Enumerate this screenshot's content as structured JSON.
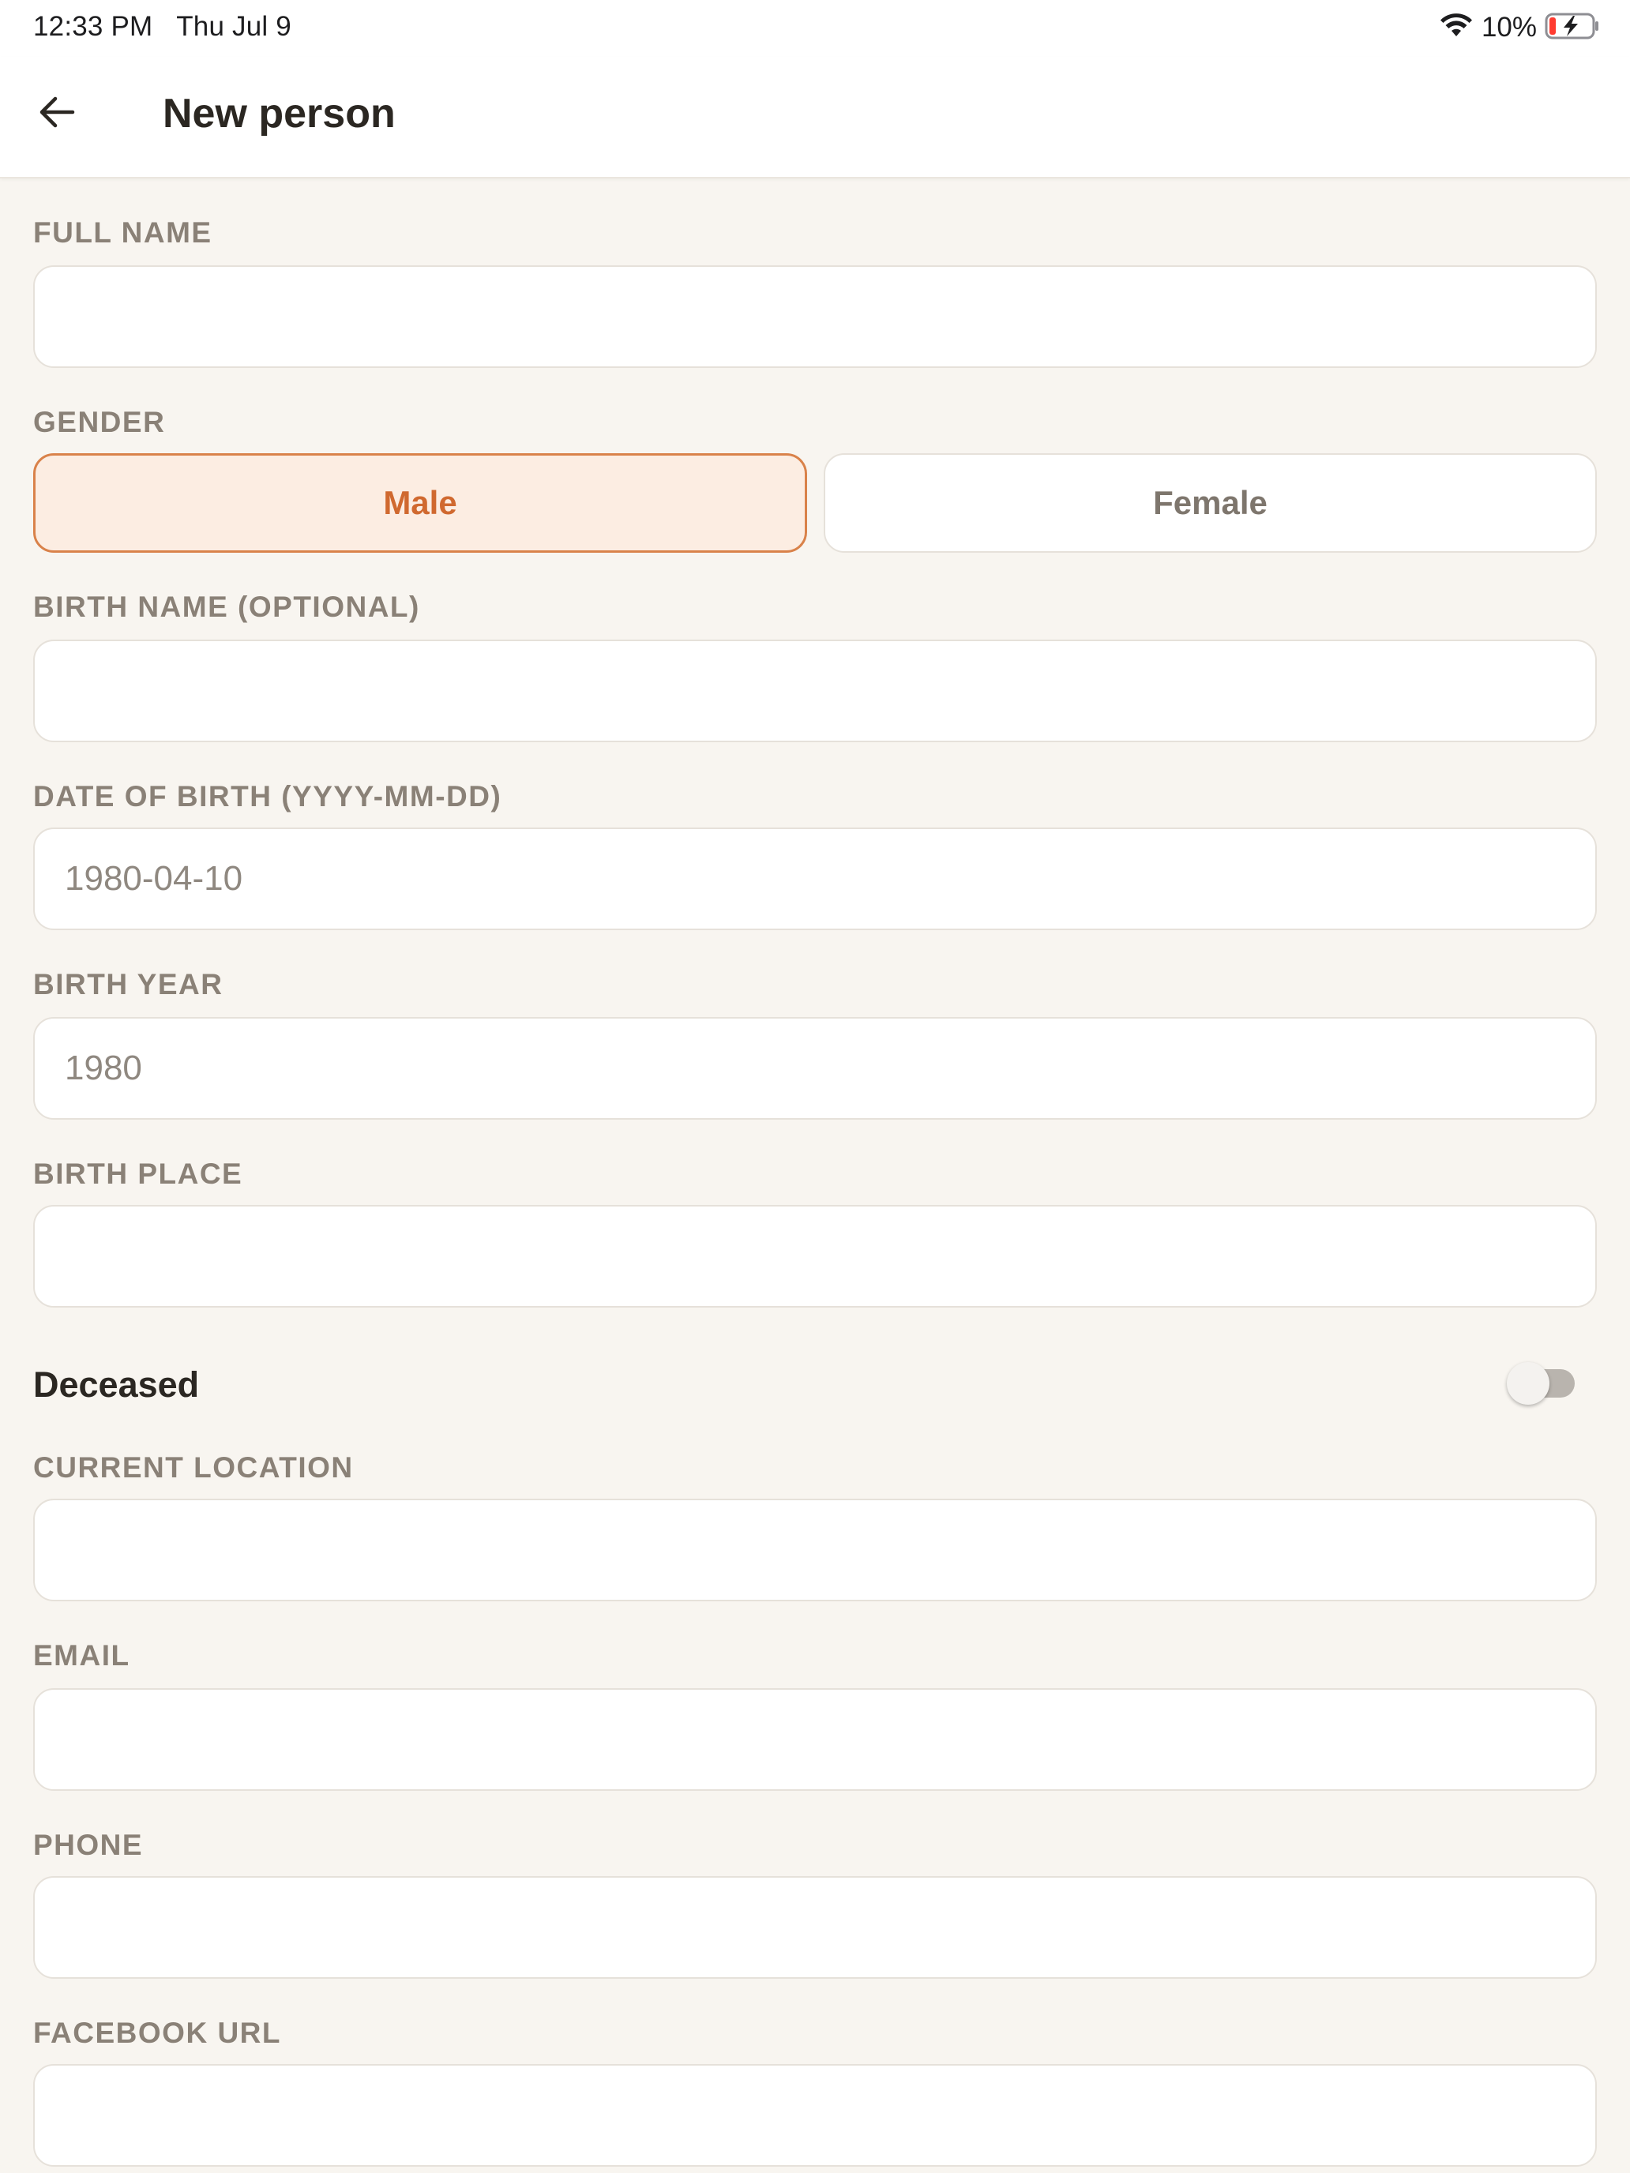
{
  "status_bar": {
    "time": "12:33 PM",
    "date": "Thu Jul 9",
    "battery_percent": "10%",
    "icons": [
      "wifi-icon",
      "battery-charging-icon"
    ]
  },
  "header": {
    "back_icon": "arrow-left-icon",
    "title": "New person"
  },
  "form": {
    "full_name": {
      "label": "FULL NAME",
      "value": "",
      "placeholder": ""
    },
    "gender": {
      "label": "GENDER",
      "options": [
        "Male",
        "Female"
      ],
      "selected": "Male"
    },
    "birth_name": {
      "label": "BIRTH NAME (OPTIONAL)",
      "value": "",
      "placeholder": ""
    },
    "date_of_birth": {
      "label": "DATE OF BIRTH (YYYY-MM-DD)",
      "value": "",
      "placeholder": "1980-04-10"
    },
    "birth_year": {
      "label": "BIRTH YEAR",
      "value": "",
      "placeholder": "1980"
    },
    "birth_place": {
      "label": "BIRTH PLACE",
      "value": "",
      "placeholder": ""
    },
    "deceased": {
      "label": "Deceased",
      "on": false
    },
    "current_location": {
      "label": "CURRENT LOCATION",
      "value": "",
      "placeholder": ""
    },
    "email": {
      "label": "EMAIL",
      "value": "",
      "placeholder": ""
    },
    "phone": {
      "label": "PHONE",
      "value": "",
      "placeholder": ""
    },
    "facebook_url": {
      "label": "FACEBOOK URL",
      "value": "",
      "placeholder": ""
    }
  },
  "colors": {
    "accent": "#d0692f",
    "accent_bg": "#fcede2",
    "page_bg": "#f8f5f0",
    "label": "#8a8177"
  }
}
